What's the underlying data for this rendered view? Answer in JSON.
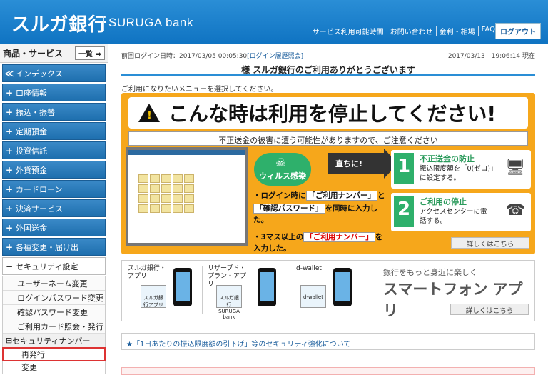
{
  "header": {
    "logo_jp": "スルガ銀行",
    "logo_en": "SURUGA bank",
    "links": [
      "サービス利用可能時間",
      "お問い合わせ",
      "金利・相場",
      "FAQ"
    ],
    "logout": "ログアウト"
  },
  "sidebar": {
    "title": "商品・サービス",
    "list_button": "一覧",
    "items": [
      {
        "sign": "≪",
        "label": "インデックス"
      },
      {
        "sign": "+",
        "label": "口座情報"
      },
      {
        "sign": "+",
        "label": "振込・振替"
      },
      {
        "sign": "+",
        "label": "定期預金"
      },
      {
        "sign": "+",
        "label": "投資信託"
      },
      {
        "sign": "+",
        "label": "外貨預金"
      },
      {
        "sign": "+",
        "label": "カードローン"
      },
      {
        "sign": "+",
        "label": "決済サービス"
      },
      {
        "sign": "+",
        "label": "外国送金"
      },
      {
        "sign": "+",
        "label": "各種変更・届け出"
      }
    ],
    "security": {
      "sign": "−",
      "label": "セキュリティ設定",
      "sub_items": [
        "ユーザーネーム変更",
        "ログインパスワード変更",
        "確認パスワード変更",
        "ご利用カード照会・発行"
      ],
      "number_head": "セキュリティナンバー",
      "number_items": [
        "再発行",
        "変更"
      ]
    }
  },
  "main": {
    "last_login_label": "前回ログイン日時：2017/03/05 00:05:30",
    "login_history": "[ログイン履歴照会]",
    "datetime": "2017/03/13　19:06:14 現在",
    "welcome": "様 スルガ銀行のご利用ありがとうございます",
    "prompt": "ご利用になりたいメニューを選択してください。",
    "warning": {
      "title": "こんな時は利用を停止してください!",
      "subtitle": "不正送金の被害に遭う可能性がありますので、ご注意ください",
      "virus": "ウィルス感染",
      "arrow": "直ちに!",
      "cause1_a": "・ログイン時に",
      "cause1_b": "「ご利用ナンバー」",
      "cause1_c": "と",
      "cause1_d": "「確認パスワード」",
      "cause1_e": "を同時に入力した。",
      "cause2_a": "・3マス以上の",
      "cause2_b": "「ご利用ナンバー」",
      "cause2_c": "を入力した。",
      "step1_num": "1",
      "step1_title": "不正送金の防止",
      "step1_desc": "振込限度額を「0(ゼロ)」に設定する。",
      "step2_num": "2",
      "step2_title": "ご利用の停止",
      "step2_desc": "アクセスセンターに電話する。",
      "more": "詳しくはこちら"
    },
    "apps": {
      "app1": "スルガ銀行・アプリ",
      "app1_icon": "スルガ銀行アプリ",
      "app2": "リザーブド・プラン・アプリ",
      "app2_icon": "スルガ銀行 SURUGA bank",
      "app3": "d-wallet",
      "app3_icon": "d-wallet",
      "promo_small": "銀行をもっと身近に楽しく",
      "promo_big": "スマートフォン アプリ",
      "more": "詳しくはこちら"
    },
    "notice": "★「1日あたりの振込限度額の引下げ」等のセキュリティ強化について"
  }
}
